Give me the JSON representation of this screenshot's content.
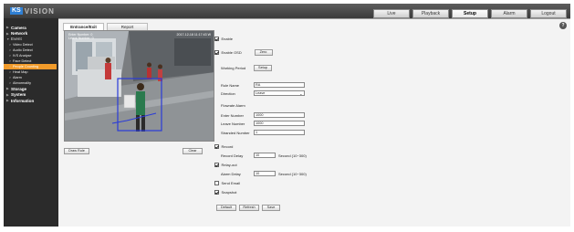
{
  "brand": {
    "logo_prefix": "KS",
    "logo_rest": "VISION"
  },
  "topnav": [
    {
      "label": "Live"
    },
    {
      "label": "Playback"
    },
    {
      "label": "Setup",
      "active": true
    },
    {
      "label": "Alarm"
    },
    {
      "label": "Logout"
    }
  ],
  "sidebar": {
    "items": [
      {
        "label": "Camera"
      },
      {
        "label": "Network"
      },
      {
        "label": "Event"
      }
    ],
    "event_subitems": [
      {
        "label": "Video Detect"
      },
      {
        "label": "Audio Detect"
      },
      {
        "label": "IVS Analyse"
      },
      {
        "label": "Face Detect"
      },
      {
        "label": "People Counting",
        "selected": true
      },
      {
        "label": "Heat Map"
      },
      {
        "label": "Alarm"
      },
      {
        "label": "Abnormality"
      }
    ],
    "bottom_items": [
      {
        "label": "Storage"
      },
      {
        "label": "System"
      },
      {
        "label": "Information"
      }
    ]
  },
  "tabs": [
    {
      "label": "Entrance/Exit",
      "active": true
    },
    {
      "label": "Report"
    }
  ],
  "video": {
    "osd_time": "2017-12-18 11:17:43 W",
    "osd_left": "Enter Number: 0\nLeave Number: 0"
  },
  "buttons": {
    "draw_rule": "Draw Rule",
    "clear": "Clear",
    "zero": "Zero",
    "setup": "Setup",
    "default": "Default",
    "refresh": "Refresh",
    "save": "Save"
  },
  "form": {
    "enable_label": "Enable",
    "enable_osd_label": "Enable OSD",
    "working_period_label": "Working Period",
    "rule_name_label": "Rule Name",
    "rule_name_value": "RA",
    "direction_label": "Direction",
    "direction_value": "Leave",
    "flowrate_alarm_label": "Flowrate Alarm",
    "enter_number_label": "Enter Number",
    "enter_number_value": "1000",
    "leave_number_label": "Leave Number",
    "leave_number_value": "1000",
    "stranded_number_label": "Stranded Number",
    "stranded_number_value": "1",
    "record_label": "Record",
    "record_delay_label": "Record Delay",
    "record_delay_value": "10",
    "second_range": "Second (10~300)",
    "relay_out_label": "Relay-out",
    "alarm_delay_label": "Alarm Delay",
    "alarm_delay_value": "10",
    "send_email_label": "Send Email",
    "snapshot_label": "Snapshot"
  },
  "icons": {
    "help": "?"
  },
  "colors": {
    "accent": "#f29b2a",
    "detect_box": "#2a3bd8",
    "brand": "#2f7fd3"
  }
}
